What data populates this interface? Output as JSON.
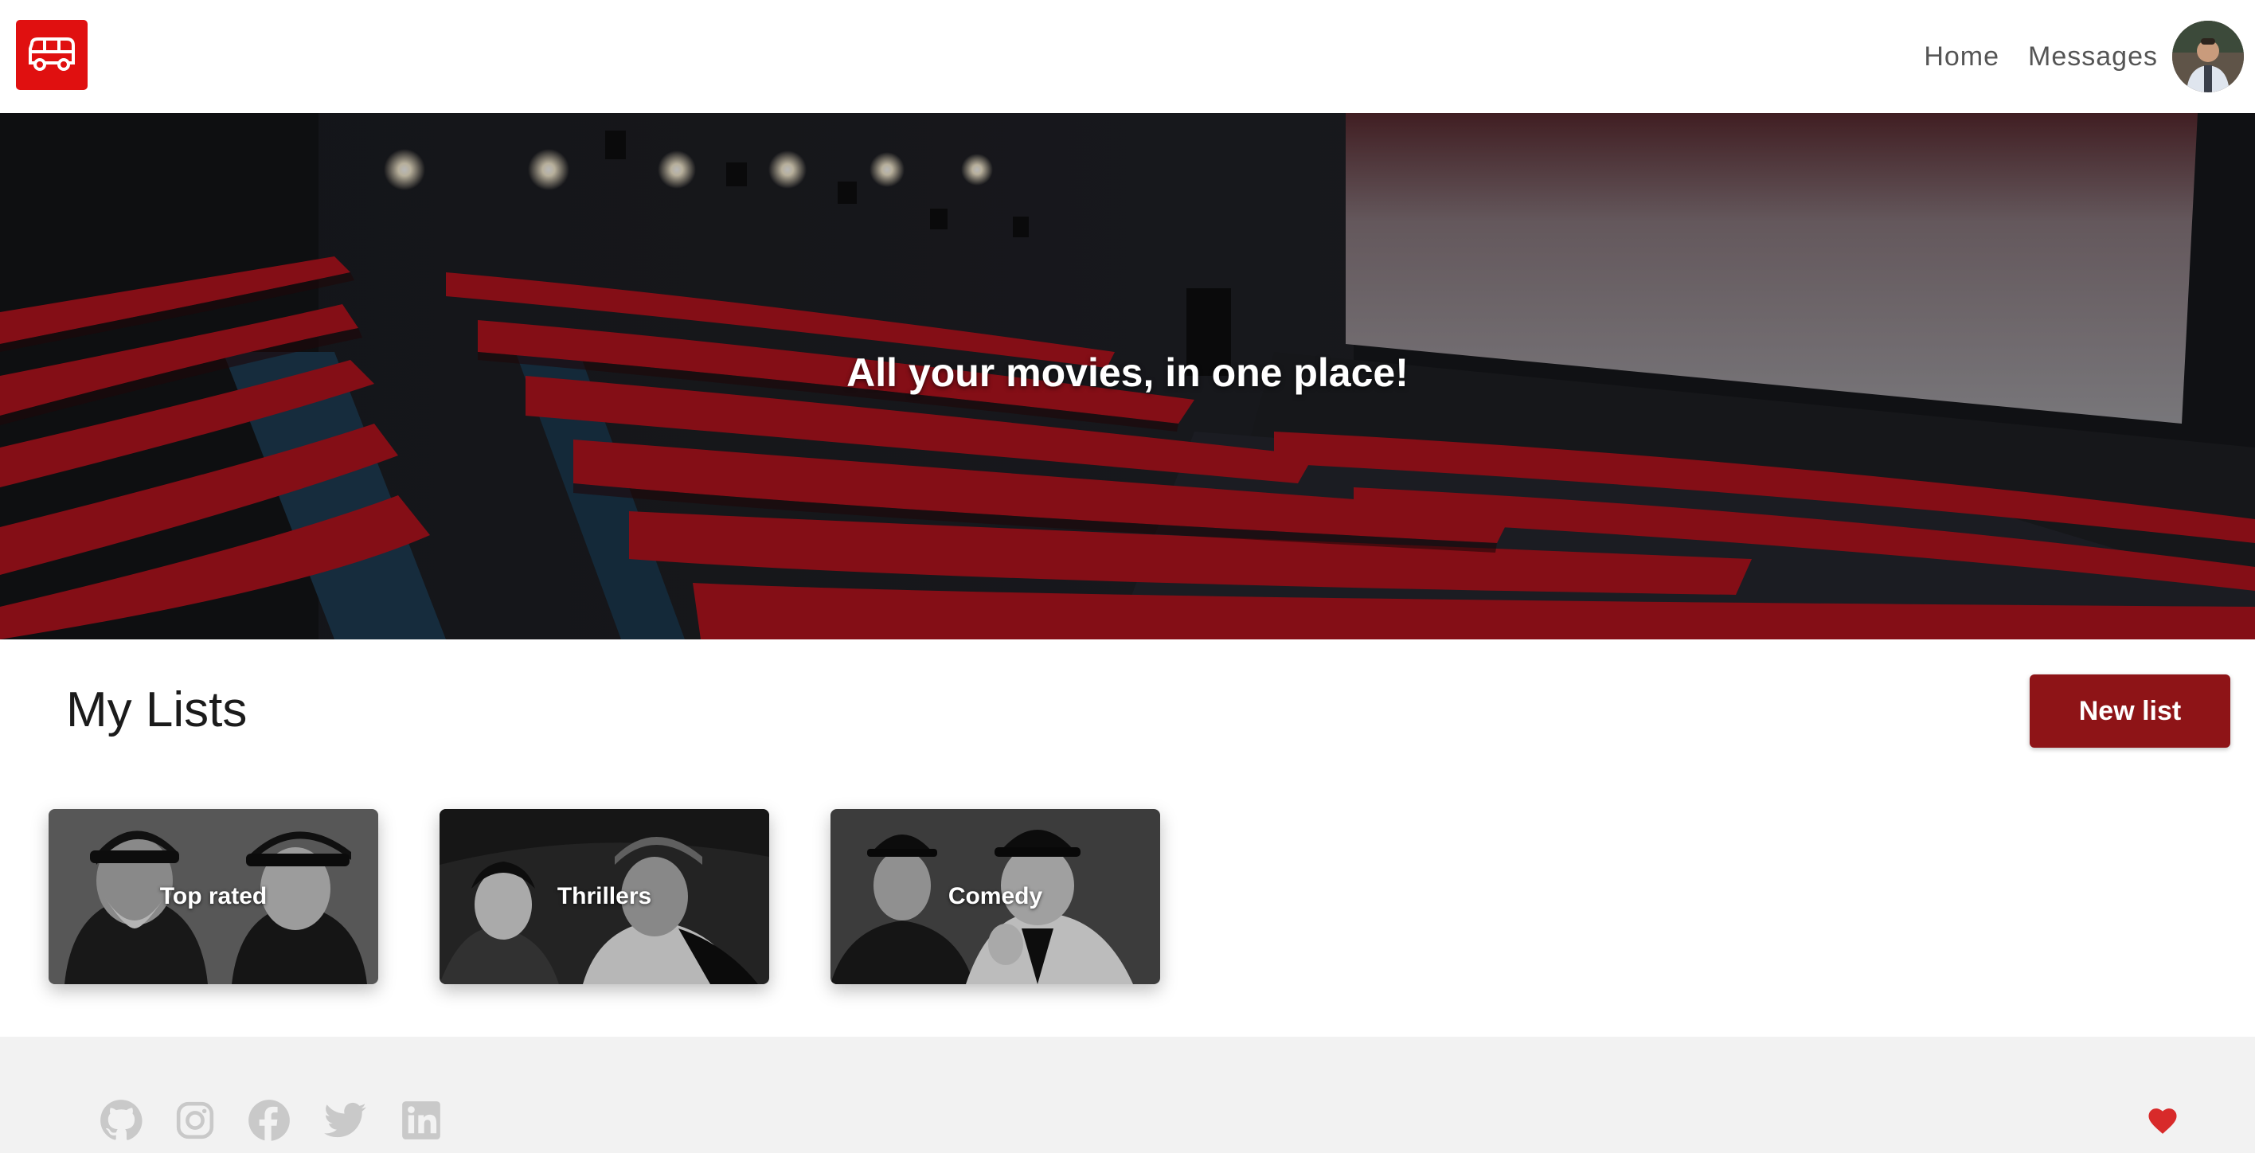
{
  "navbar": {
    "logo_icon": "bus-icon",
    "links": [
      {
        "label": "Home"
      },
      {
        "label": "Messages"
      }
    ],
    "avatar_icon": "user-avatar"
  },
  "hero": {
    "title": "All your movies, in one place!",
    "image": "cinema-auditorium-photo"
  },
  "lists_section": {
    "title": "My Lists",
    "new_button_label": "New list"
  },
  "lists": [
    {
      "label": "Top rated",
      "image": "two-sailors-photo"
    },
    {
      "label": "Thrillers",
      "image": "noir-couple-photo"
    },
    {
      "label": "Comedy",
      "image": "comedy-duo-photo"
    }
  ],
  "footer": {
    "social_icons": [
      "github-icon",
      "instagram-icon",
      "facebook-icon",
      "twitter-icon",
      "linkedin-icon"
    ],
    "heart_icon": "heart-icon",
    "accent_color": "#e01010",
    "button_color": "#8e1417",
    "heart_color": "#d82a2a"
  }
}
